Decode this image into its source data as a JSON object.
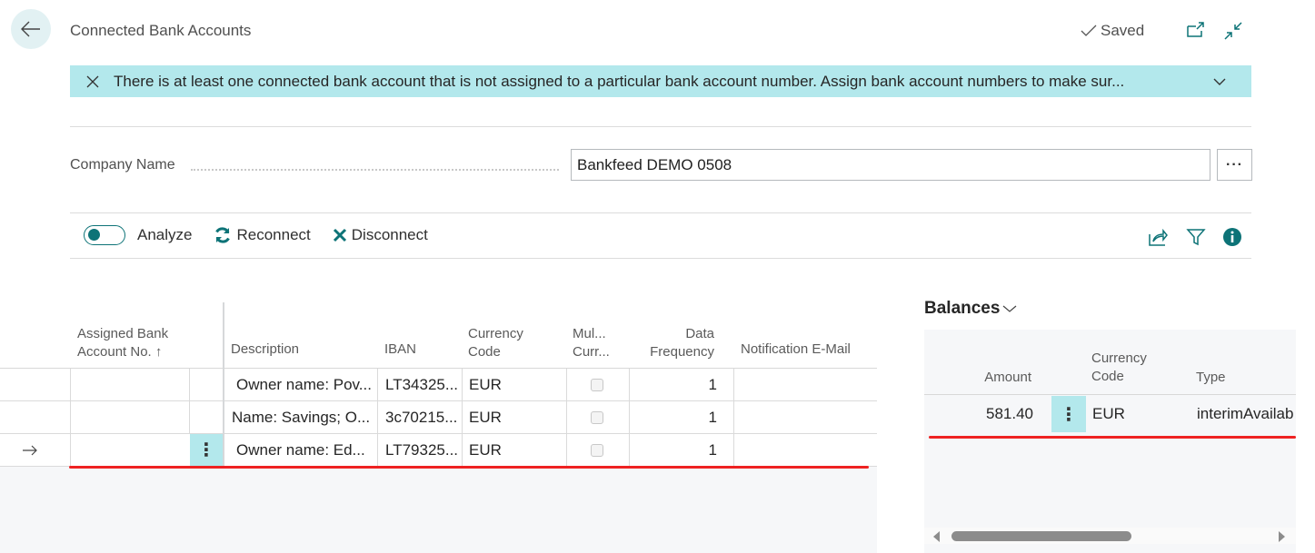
{
  "header": {
    "title": "Connected Bank Accounts",
    "saved_label": "Saved"
  },
  "banner": {
    "message": "There is at least one connected bank account that is not assigned to a particular bank account number. Assign bank account numbers to make sur..."
  },
  "company": {
    "label": "Company Name",
    "value": "Bankfeed DEMO 0508"
  },
  "actions": {
    "analyze": "Analyze",
    "analyze_on": true,
    "reconnect": "Reconnect",
    "disconnect": "Disconnect"
  },
  "accounts_table": {
    "columns": {
      "assigned_bank_account_no": "Assigned Bank Account No. ↑",
      "assigned_line1": "Assigned Bank",
      "assigned_line2": "Account No. ↑",
      "description": "Description",
      "iban": "IBAN",
      "currency_line1": "Currency",
      "currency_line2": "Code",
      "multi_line1": "Mul...",
      "multi_line2": "Curr...",
      "freq_line1": "Data",
      "freq_line2": "Frequency",
      "notification_email": "Notification E-Mail"
    },
    "rows": [
      {
        "assigned": "",
        "description": "Owner name: Pov...",
        "iban": "LT34325...",
        "currency": "EUR",
        "multi_currency": false,
        "data_frequency": "1",
        "notification_email": "",
        "selected": false
      },
      {
        "assigned": "",
        "description": "Name: Savings; O...",
        "iban": "3c70215...",
        "currency": "EUR",
        "multi_currency": false,
        "data_frequency": "1",
        "notification_email": "",
        "selected": false
      },
      {
        "assigned": "",
        "description": "Owner name: Ed...",
        "iban": "LT79325...",
        "currency": "EUR",
        "multi_currency": false,
        "data_frequency": "1",
        "notification_email": "",
        "selected": true
      }
    ]
  },
  "balances": {
    "title": "Balances",
    "columns": {
      "amount": "Amount",
      "currency_line1": "Currency",
      "currency_line2": "Code",
      "type": "Type"
    },
    "rows": [
      {
        "amount": "581.40",
        "currency": "EUR",
        "type": "interimAvailab"
      }
    ]
  },
  "colors": {
    "accent": "#0d7377",
    "banner_bg": "#b3e8ec",
    "highlight": "#ee2222"
  }
}
